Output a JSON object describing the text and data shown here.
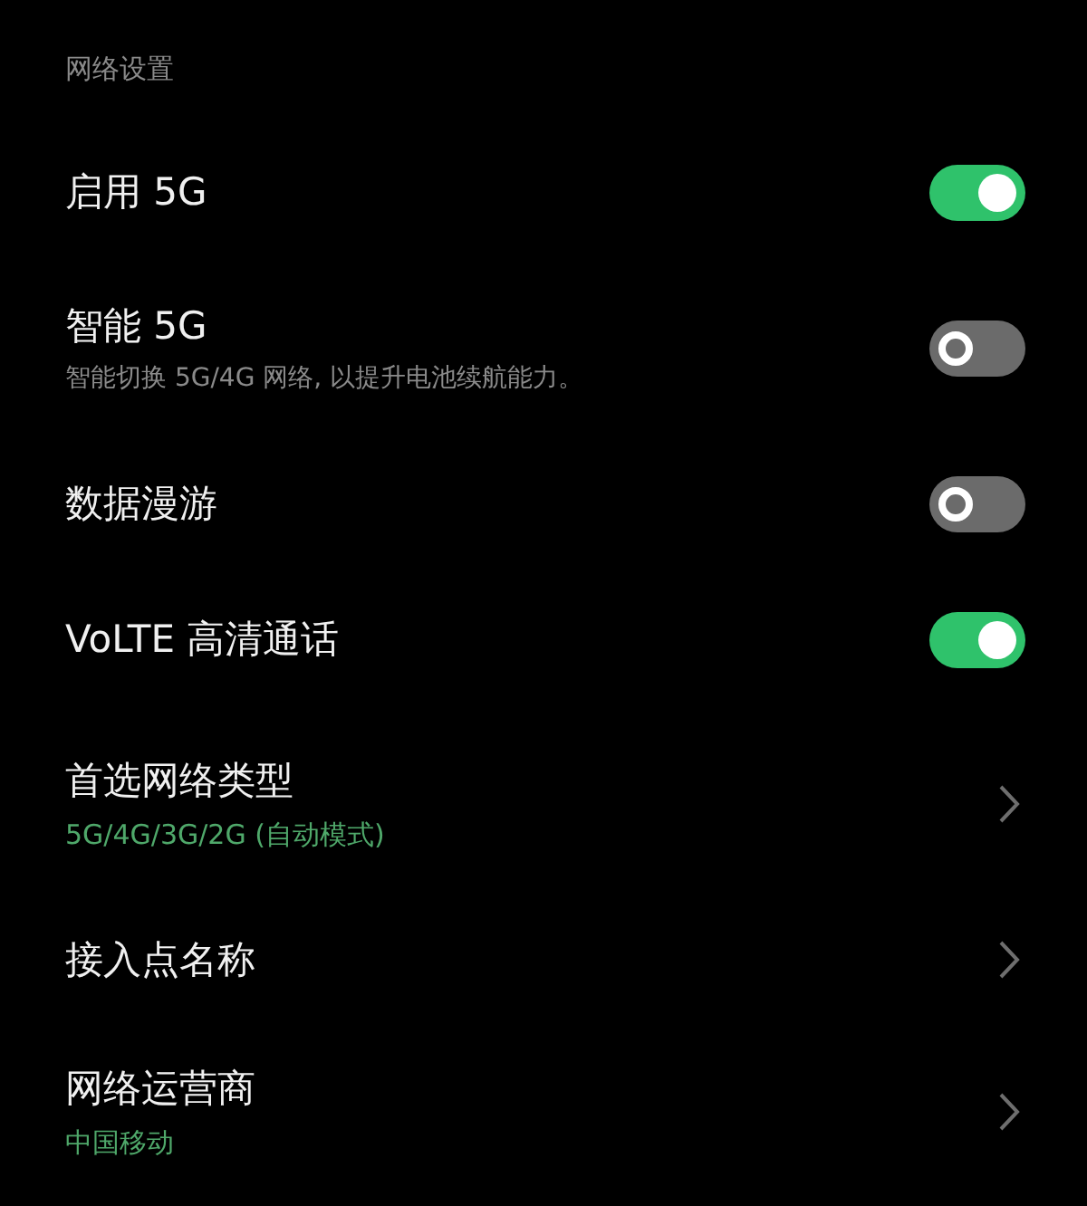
{
  "section_header": "网络设置",
  "rows": [
    {
      "kind": "toggle",
      "title": "启用 5G",
      "on": true
    },
    {
      "kind": "toggle",
      "title": "智能 5G",
      "subtitle": "智能切换 5G/4G 网络, 以提升电池续航能力。",
      "on": false
    },
    {
      "kind": "toggle",
      "title": "数据漫游",
      "on": false
    },
    {
      "kind": "toggle",
      "title": "VoLTE 高清通话",
      "on": true
    },
    {
      "kind": "link",
      "title": "首选网络类型",
      "value": "5G/4G/3G/2G (自动模式)"
    },
    {
      "kind": "link",
      "title": "接入点名称"
    },
    {
      "kind": "link",
      "title": "网络运营商",
      "value": "中国移动"
    }
  ]
}
